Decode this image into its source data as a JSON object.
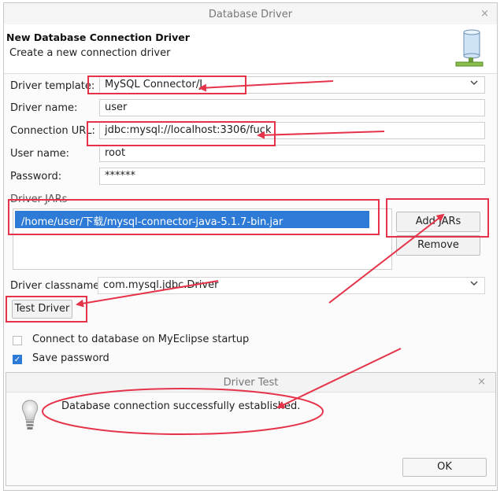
{
  "window": {
    "title": "Database Driver",
    "close": "×"
  },
  "header": {
    "title": "New Database Connection Driver",
    "subtitle": "Create a new connection driver"
  },
  "form": {
    "driver_template": {
      "label": "Driver template:",
      "value": "MySQL Connector/J"
    },
    "driver_name": {
      "label": "Driver name:",
      "value": "user"
    },
    "connection_url": {
      "label": "Connection URL:",
      "value": "jdbc:mysql://localhost:3306/fuck"
    },
    "user_name": {
      "label": "User name:",
      "value": "root"
    },
    "password": {
      "label": "Password:",
      "value": "******"
    }
  },
  "jars": {
    "label": "Driver JARs",
    "items": [
      "/home/user/下载/mysql-connector-java-5.1.7-bin.jar"
    ],
    "add_button": "Add JARs",
    "remove_button": "Remove"
  },
  "classname": {
    "label": "Driver classname:",
    "value": "com.mysql.jdbc.Driver"
  },
  "test_button": "Test Driver",
  "options": {
    "connect_startup": {
      "label": "Connect to database on MyEclipse startup",
      "checked": false
    },
    "save_password": {
      "label": "Save password",
      "checked": true
    }
  },
  "driver_test": {
    "title": "Driver Test",
    "close": "×",
    "message": "Database connection successfully established.",
    "ok_button": "OK"
  },
  "icons": {
    "dropdown": "chevron-down-icon",
    "database": "database-icon",
    "lightbulb": "lightbulb-icon",
    "check": "checkmark-icon"
  },
  "annotation_color": "#e5344a"
}
